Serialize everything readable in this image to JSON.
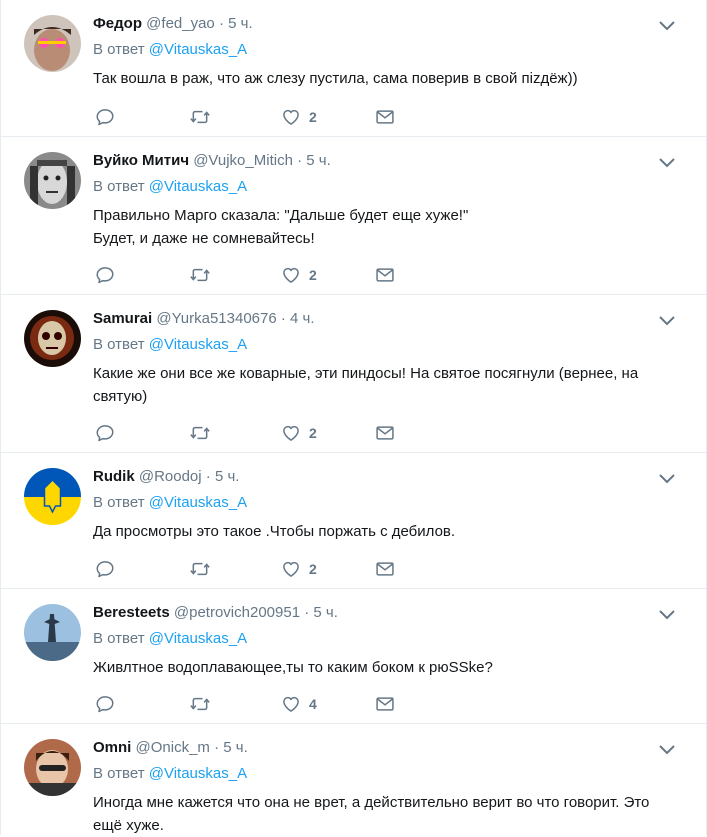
{
  "tweets": [
    {
      "name": "Федор",
      "handle": "@fed_yao",
      "dot": "·",
      "time": "5 ч.",
      "reply_prefix": "В ответ",
      "reply_to": "@Vitauskas_A",
      "text": "Так вошла в раж, что аж слезу пустила, сама поверив в свой пizдёж))",
      "likes": "2",
      "avatar_color": "#8c6a5a"
    },
    {
      "name": "Вуйко Митич",
      "handle": "@Vujko_Mitich",
      "dot": "·",
      "time": "5 ч.",
      "reply_prefix": "В ответ",
      "reply_to": "@Vitauskas_A",
      "text": "Правильно Марго сказала: \"Дальше будет еще хуже!\"\nБудет, и даже не сомневайтесь!",
      "likes": "2",
      "avatar_color": "#3a3a3a"
    },
    {
      "name": "Samurai",
      "handle": "@Yurka51340676",
      "dot": "·",
      "time": "4 ч.",
      "reply_prefix": "В ответ",
      "reply_to": "@Vitauskas_A",
      "text": "Какие же они все же коварные, эти пиндосы! На святое посягнули (вернее, на святую)",
      "likes": "2",
      "avatar_color": "#2a1a10"
    },
    {
      "name": "Rudik",
      "handle": "@Roodoj",
      "dot": "·",
      "time": "5 ч.",
      "reply_prefix": "В ответ",
      "reply_to": "@Vitauskas_A",
      "text": "Да просмотры это такое .Чтобы поржать с дебилов.",
      "likes": "2",
      "avatar_color": "#0057b7"
    },
    {
      "name": "Beresteets",
      "handle": "@petrovich200951",
      "dot": "·",
      "time": "5 ч.",
      "reply_prefix": "В ответ",
      "reply_to": "@Vitauskas_A",
      "text": "Живлтное водоплавающее,ты то каким боком к рюSSke?",
      "likes": "4",
      "avatar_color": "#8fb3d6"
    },
    {
      "name": "Omni",
      "handle": "@Onick_m",
      "dot": "·",
      "time": "5 ч.",
      "reply_prefix": "В ответ",
      "reply_to": "@Vitauskas_A",
      "text": "Иногда мне кажется что она не врет, а действительно верит во что говорит. Это ещё хуже.",
      "likes": "",
      "avatar_color": "#6b4a3a"
    }
  ]
}
